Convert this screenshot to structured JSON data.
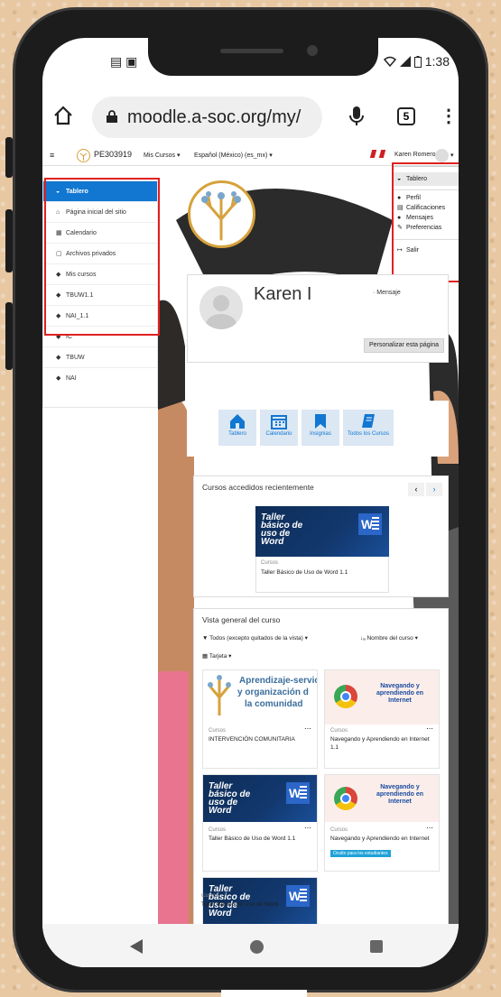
{
  "status_bar": {
    "left_icons": "▤ ▣",
    "time": "1:38"
  },
  "browser": {
    "url": "moodle.a-soc.org/my/",
    "tab_count": "5"
  },
  "moodle_nav": {
    "site_short": "PE303919",
    "my_courses": "Mis Cursos",
    "language": "Español (México) (es_mx)",
    "user_name": "Karen Romero"
  },
  "sidebar": {
    "items": [
      {
        "label": "Tablero",
        "icon": "dashboard-icon",
        "active": true
      },
      {
        "label": "Página inicial del sitio",
        "icon": "home-icon"
      },
      {
        "label": "Calendario",
        "icon": "calendar-icon"
      },
      {
        "label": "Archivos privados",
        "icon": "file-icon"
      },
      {
        "label": "Mis cursos",
        "icon": "graduation-cap-icon"
      },
      {
        "label": "TBUW1.1",
        "icon": "graduation-cap-icon"
      },
      {
        "label": "NAI_1.1",
        "icon": "graduation-cap-icon"
      },
      {
        "label": "IC",
        "icon": "graduation-cap-icon"
      },
      {
        "label": "TBUW",
        "icon": "graduation-cap-icon"
      },
      {
        "label": "NAI",
        "icon": "graduation-cap-icon"
      }
    ]
  },
  "user_menu": {
    "items": [
      {
        "label": "Tablero",
        "icon": "dashboard-icon"
      },
      {
        "label": "Perfil",
        "icon": "user-icon"
      },
      {
        "label": "Calificaciones",
        "icon": "table-icon"
      },
      {
        "label": "Mensajes",
        "icon": "comment-icon"
      },
      {
        "label": "Preferencias",
        "icon": "wrench-icon"
      },
      {
        "label": "Salir",
        "icon": "sign-out-icon"
      }
    ]
  },
  "profile": {
    "name": "Karen I",
    "message_link": "Mensaje",
    "customize_button": "Personalizar esta página"
  },
  "quick_links": [
    {
      "label": "Tablero",
      "icon": "home-icon"
    },
    {
      "label": "Calendario",
      "icon": "calendar-icon"
    },
    {
      "label": "Insignias",
      "icon": "bookmark-icon"
    },
    {
      "label": "Todos los Cursos",
      "icon": "book-icon"
    }
  ],
  "recent": {
    "title": "Cursos accedidos recientemente",
    "course": {
      "category": "Cursos",
      "name": "Taller Básico de Uso de Word 1.1",
      "banner_title": "Taller básico de uso de Word"
    }
  },
  "overview": {
    "title": "Vista general del curso",
    "filter": "Todos (excepto quitados de la vista)",
    "sort": "Nombre del curso",
    "view": "Tarjeta",
    "courses": [
      {
        "category": "Cursos",
        "name": "INTERVENCIÓN COMUNITARIA",
        "banner": "Aprendizaje-servicio y organización de la comunidad",
        "banner_lines": [
          "Aprendizaje-servic",
          "y organización d",
          "la comunidad"
        ]
      },
      {
        "category": "Cursos",
        "name": "Navegando y Aprendiendo en Internet 1.1",
        "banner_lines": [
          "Navegando y",
          "aprendiendo en",
          "Internet"
        ]
      },
      {
        "category": "Cursos",
        "name": "Taller Básico de Uso de Word 1.1",
        "banner_title": "Taller básico de uso de Word"
      },
      {
        "category": "Cursos",
        "name": "Navegando y Aprendiendo en Internet",
        "badge": "Oculto para los estudiantes",
        "banner_lines": [
          "Navegando y",
          "aprendiendo en",
          "Internet"
        ]
      },
      {
        "category": "Cursos",
        "name": "Taller Básico de Uso de Word",
        "banner_title": "Taller básico de uso de Word"
      }
    ]
  },
  "colors": {
    "accent": "#1177d1",
    "highlight": "#e02020",
    "phone_bg": "#e7c8a3"
  }
}
